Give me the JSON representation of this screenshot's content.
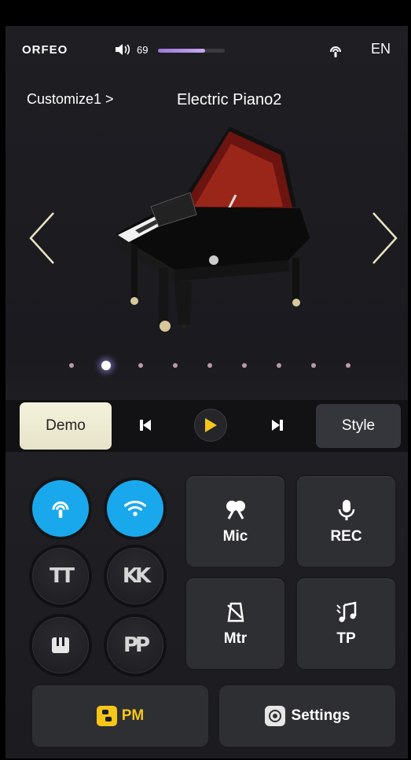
{
  "status": {
    "logo": "ORFEO",
    "volume": "69",
    "volume_level": 0.7,
    "language": "EN"
  },
  "header": {
    "breadcrumb": "Customize1 >",
    "voice_name": "Electric Piano2"
  },
  "carousel": {
    "total_pages": 9,
    "active_index": 1
  },
  "transport": {
    "demo_label": "Demo",
    "style_label": "Style"
  },
  "round_buttons": [
    {
      "name": "bluetooth-audio-button",
      "icon": "bluetooth-audio-icon",
      "active": true
    },
    {
      "name": "wifi-button",
      "icon": "wifi-icon",
      "active": true
    },
    {
      "name": "touch-tone-button",
      "text": "TT",
      "active": false
    },
    {
      "name": "key-button",
      "text": "KK",
      "active": false
    },
    {
      "name": "piano-keys-button",
      "icon": "piano-keys-icon",
      "active": false
    },
    {
      "name": "pp-button",
      "text": "PP",
      "active": false
    }
  ],
  "tiles": {
    "mic": "Mic",
    "rec": "REC",
    "mtr": "Mtr",
    "tp": "TP"
  },
  "bottom": {
    "pm_label": "PM",
    "settings_label": "Settings"
  },
  "colors": {
    "accent_blue": "#1aa8ec",
    "play_yellow": "#f5c518",
    "volume_purple": "#b18ee6",
    "demo_cream": "#f0eed6"
  }
}
